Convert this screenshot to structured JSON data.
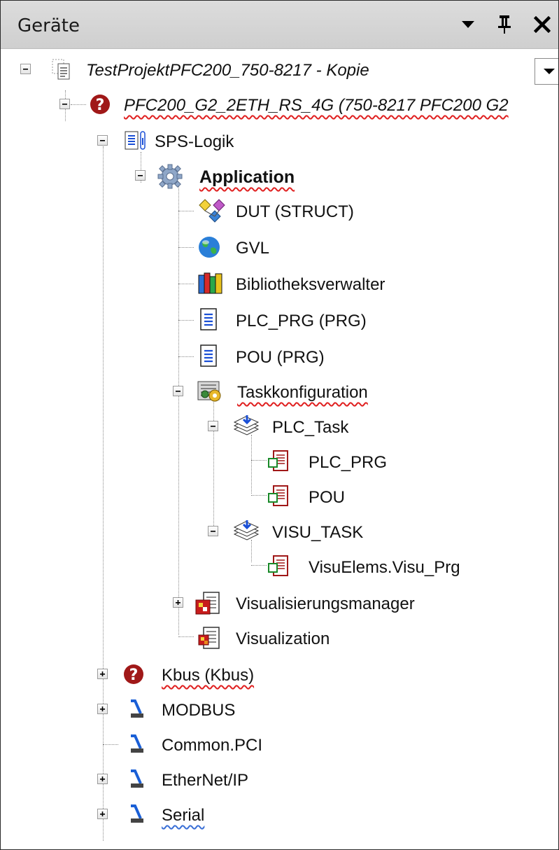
{
  "window": {
    "title": "Geräte",
    "dropdown_icon": "chevron-down-icon",
    "pin_icon": "pin-icon",
    "close_icon": "close-icon",
    "pin_glyph": "❡",
    "close_glyph": "✖"
  },
  "tree": {
    "project": {
      "label": "TestProjektPFC200_750-8217 - Kopie",
      "icon": "project-icon",
      "expanded": true
    },
    "device": {
      "label": "PFC200_G2_2ETH_RS_4G (750-8217 PFC200 G2",
      "icon": "error-question-icon",
      "expanded": true
    },
    "plc_logic": {
      "label": "SPS-Logik",
      "icon": "plc-logic-icon",
      "expanded": true
    },
    "application": {
      "label": "Application",
      "icon": "gear-icon",
      "expanded": true
    },
    "app_items": [
      {
        "label": "DUT (STRUCT)",
        "icon": "dut-icon"
      },
      {
        "label": "GVL",
        "icon": "globe-icon"
      },
      {
        "label": "Bibliotheksverwalter",
        "icon": "books-icon"
      },
      {
        "label": "PLC_PRG (PRG)",
        "icon": "document-icon"
      },
      {
        "label": "POU (PRG)",
        "icon": "document-icon"
      }
    ],
    "task_config": {
      "label": "Taskkonfiguration",
      "icon": "task-config-icon",
      "expanded": true
    },
    "plc_task": {
      "label": "PLC_Task",
      "icon": "task-icon",
      "expanded": true
    },
    "plc_task_items": [
      {
        "label": "PLC_PRG",
        "icon": "program-call-icon"
      },
      {
        "label": "POU",
        "icon": "program-call-icon"
      }
    ],
    "visu_task": {
      "label": "VISU_TASK",
      "icon": "task-icon",
      "expanded": true
    },
    "visu_task_items": [
      {
        "label": "VisuElems.Visu_Prg",
        "icon": "program-call-icon"
      }
    ],
    "visu_manager": {
      "label": "Visualisierungsmanager",
      "icon": "visu-manager-icon",
      "expanded": false
    },
    "visualization": {
      "label": "Visualization",
      "icon": "visualization-icon"
    },
    "buses": [
      {
        "label": "Kbus (Kbus)",
        "icon": "error-question-icon",
        "expanded": false
      },
      {
        "label": "MODBUS",
        "icon": "fieldbus-icon",
        "expanded": false
      },
      {
        "label": "Common.PCI",
        "icon": "fieldbus-icon"
      },
      {
        "label": "EtherNet/IP",
        "icon": "fieldbus-icon",
        "expanded": false
      },
      {
        "label": "Serial",
        "icon": "fieldbus-icon",
        "expanded": false
      }
    ]
  },
  "colors": {
    "titlebar": "#d6d6d6",
    "error_red": "#a01818",
    "squiggle": "#e02020",
    "tree_line": "#8a8a8a"
  }
}
